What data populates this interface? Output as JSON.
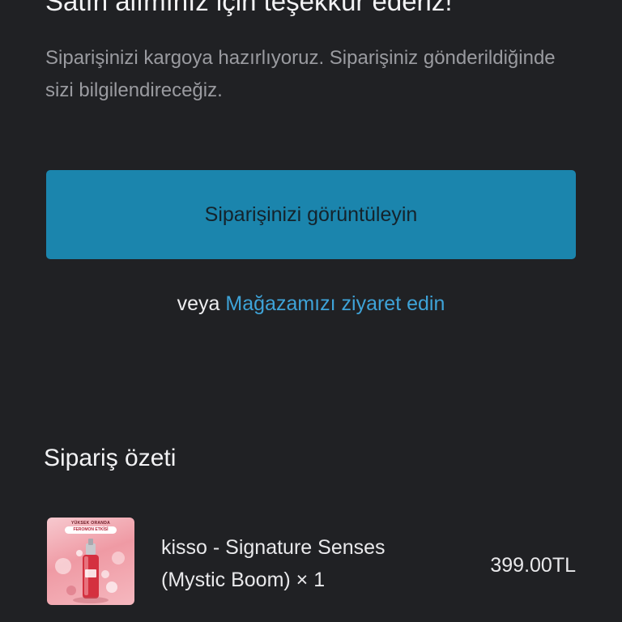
{
  "confirmation": {
    "title": "Satın alımınız için teşekkür ederiz!",
    "subtitle": "Siparişinizi kargoya hazırlıyoruz. Siparişiniz gönderildiğinde sizi bilgilendireceğiz."
  },
  "actions": {
    "view_order_label": "Siparişinizi görüntüleyin",
    "or_text": "veya",
    "visit_store_label": "Mağazamızı ziyaret edin"
  },
  "summary": {
    "heading": "Sipariş özeti",
    "items": [
      {
        "name": "kisso - Signature Senses (Mystic Boom) × 1",
        "price": "399.00TL",
        "image_text_top": "YÜKSEK ORANDA",
        "image_badge": "FEROMON ETKİSİ",
        "image_icon": "perfume-bottle-icon"
      }
    ]
  },
  "colors": {
    "background": "#202124",
    "primary_button": "#1b85ad",
    "link": "#3ea3d8",
    "muted_text": "#9a9ba0"
  }
}
